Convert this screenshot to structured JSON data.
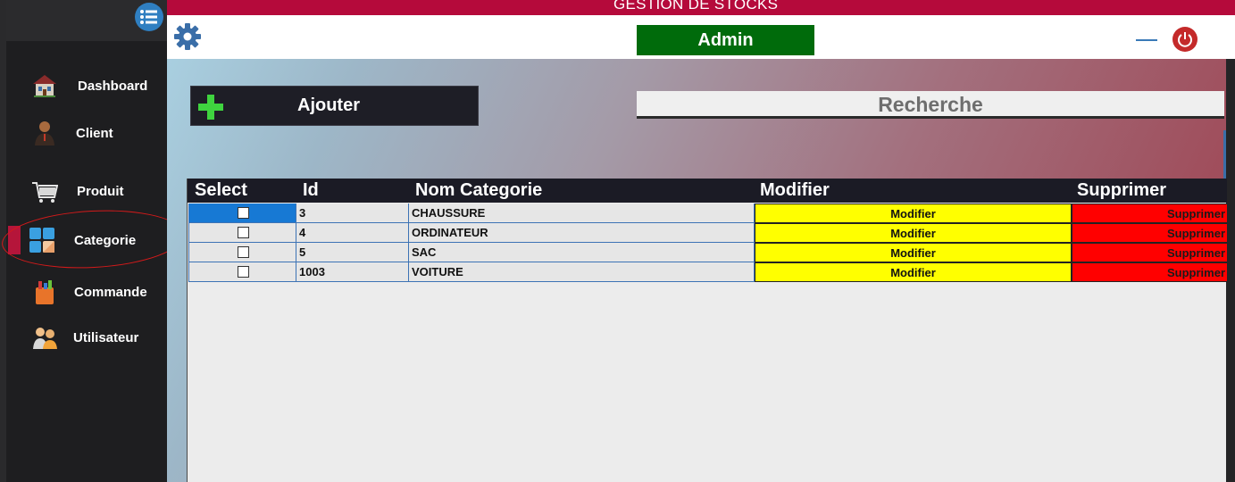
{
  "app": {
    "title": "GESTION DE STOCKS",
    "user": "Admin"
  },
  "sidebar": {
    "items": [
      {
        "label": "Dashboard",
        "icon": "house-icon"
      },
      {
        "label": "Client",
        "icon": "person-icon"
      },
      {
        "label": "Produit",
        "icon": "cart-icon"
      },
      {
        "label": "Categorie",
        "icon": "categories-icon",
        "active": true
      },
      {
        "label": "Commande",
        "icon": "order-bag-icon"
      },
      {
        "label": "Utilisateur",
        "icon": "users-icon"
      }
    ]
  },
  "toolbar": {
    "add_label": "Ajouter",
    "search_label": "Recherche"
  },
  "table": {
    "columns": [
      "Select",
      "Id",
      "Nom Categorie",
      "Modifier",
      "Supprimer"
    ],
    "rows": [
      {
        "id": "3",
        "nom": "CHAUSSURE",
        "modifier": "Modifier",
        "supprimer": "Supprimer"
      },
      {
        "id": "4",
        "nom": "ORDINATEUR",
        "modifier": "Modifier",
        "supprimer": "Supprimer"
      },
      {
        "id": "5",
        "nom": "SAC",
        "modifier": "Modifier",
        "supprimer": "Supprimer"
      },
      {
        "id": "1003",
        "nom": "VOITURE",
        "modifier": "Modifier",
        "supprimer": "Supprimer"
      }
    ]
  },
  "colors": {
    "accent": "#b50a3b",
    "user_badge": "#006b0b",
    "modify": "#ffff00",
    "delete": "#ff0000",
    "selected": "#1779d4"
  }
}
